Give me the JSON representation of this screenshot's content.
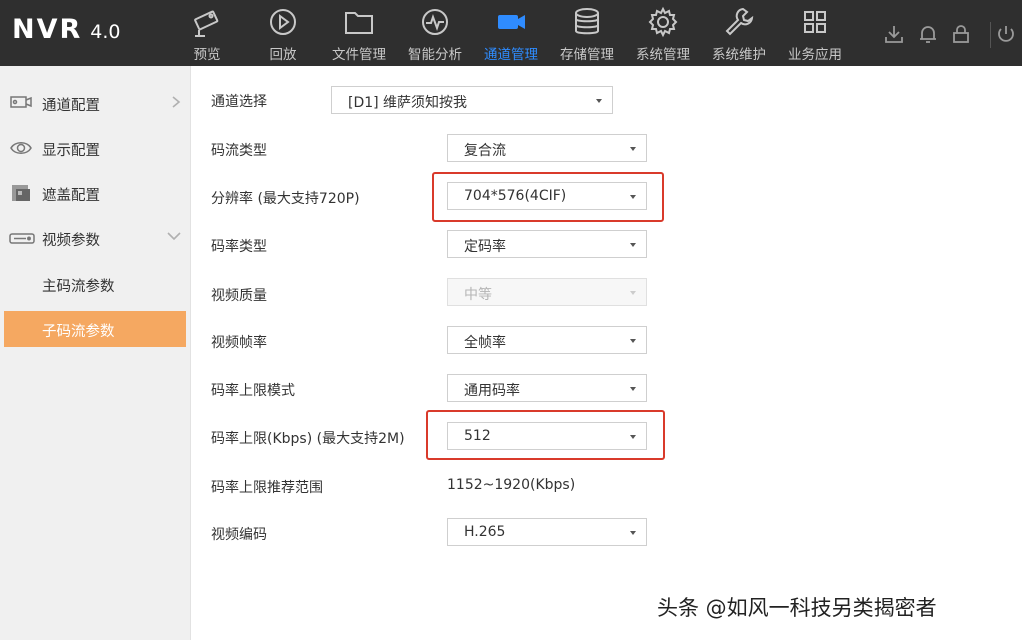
{
  "app": {
    "name": "NVR",
    "version": "4.0"
  },
  "nav": [
    {
      "label": "预览",
      "icon": "camera-icon"
    },
    {
      "label": "回放",
      "icon": "playback-icon"
    },
    {
      "label": "文件管理",
      "icon": "folder-icon"
    },
    {
      "label": "智能分析",
      "icon": "analysis-icon"
    },
    {
      "label": "通道管理",
      "icon": "channel-camera-icon",
      "active": true
    },
    {
      "label": "存储管理",
      "icon": "database-icon"
    },
    {
      "label": "系统管理",
      "icon": "gear-icon"
    },
    {
      "label": "系统维护",
      "icon": "wrench-icon"
    },
    {
      "label": "业务应用",
      "icon": "grid-apps-icon"
    }
  ],
  "top_right_icons": [
    "download-icon",
    "bell-icon",
    "lock-icon",
    "power-icon"
  ],
  "sidebar": {
    "items": [
      {
        "label": "通道配置",
        "icon": "channel-config-icon",
        "chevron": "right"
      },
      {
        "label": "显示配置",
        "icon": "eye-icon"
      },
      {
        "label": "遮盖配置",
        "icon": "mask-icon"
      },
      {
        "label": "视频参数",
        "icon": "video-param-icon",
        "chevron": "down"
      }
    ],
    "sub_items": [
      {
        "label": "主码流参数",
        "active": false
      },
      {
        "label": "子码流参数",
        "active": true
      }
    ]
  },
  "form": {
    "channel": {
      "label": "通道选择",
      "value": "[D1] 维萨须知按我"
    },
    "stream_type": {
      "label": "码流类型",
      "value": "复合流"
    },
    "resolution": {
      "label": "分辨率 (最大支持720P)",
      "value": "704*576(4CIF)"
    },
    "bitrate_type": {
      "label": "码率类型",
      "value": "定码率"
    },
    "video_quality": {
      "label": "视频质量",
      "value": "中等",
      "disabled": true
    },
    "frame_rate": {
      "label": "视频帧率",
      "value": "全帧率"
    },
    "bitrate_limit_mode": {
      "label": "码率上限模式",
      "value": "通用码率"
    },
    "bitrate_limit": {
      "label": "码率上限(Kbps) (最大支持2M)",
      "value": "512"
    },
    "bitrate_range": {
      "label": "码率上限推荐范围",
      "value": "1152~1920(Kbps)"
    },
    "video_codec": {
      "label": "视频编码",
      "value": "H.265"
    }
  },
  "colors": {
    "topbar": "#2f2f2f",
    "nav_active": "#2f8cff",
    "sidebar_active": "#f5a861",
    "highlight": "#d93a2b"
  },
  "watermark": "头条 @如风一科技另类揭密者"
}
